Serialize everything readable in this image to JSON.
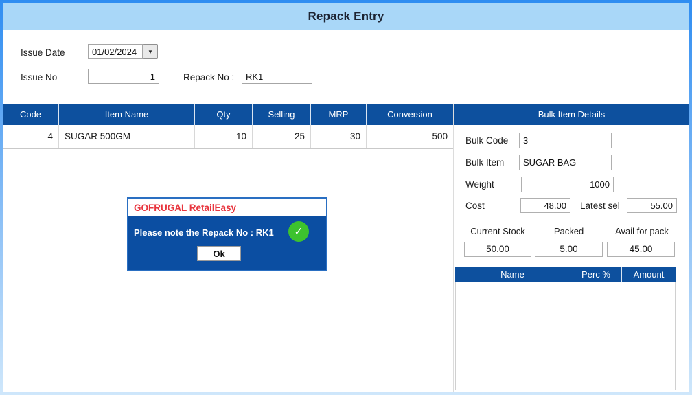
{
  "window": {
    "title": "Repack Entry"
  },
  "form": {
    "issue_date": {
      "label": "Issue Date",
      "value": "01/02/2024"
    },
    "issue_no": {
      "label": "Issue No",
      "value": "1"
    },
    "repack_no": {
      "label": "Repack No :",
      "value": "RK1"
    }
  },
  "items_table": {
    "columns": [
      "Code",
      "Item Name",
      "Qty",
      "Selling",
      "MRP",
      "Conversion"
    ],
    "rows": [
      {
        "code": "4",
        "item_name": "SUGAR 500GM",
        "qty": "10",
        "selling": "25",
        "mrp": "30",
        "conversion": "500"
      }
    ]
  },
  "bulk_panel": {
    "title": "Bulk Item Details",
    "bulk_code": {
      "label": "Bulk Code",
      "value": "3"
    },
    "bulk_item": {
      "label": "Bulk Item",
      "value": "SUGAR BAG"
    },
    "weight": {
      "label": "Weight",
      "value": "1000"
    },
    "cost": {
      "label": "Cost",
      "value": "48.00"
    },
    "latest_sel": {
      "label": "Latest sel",
      "value": "55.00"
    },
    "stock": {
      "current_stock": {
        "label": "Current Stock",
        "value": "50.00"
      },
      "packed": {
        "label": "Packed",
        "value": "5.00"
      },
      "avail_for_pack": {
        "label": "Avail for pack",
        "value": "45.00"
      }
    },
    "charges_table": {
      "columns": [
        "Name",
        "Perc %",
        "Amount"
      ],
      "rows": []
    }
  },
  "dialog": {
    "title": "GOFRUGAL RetailEasy",
    "message": "Please note the Repack No : RK1",
    "ok_label": "Ok"
  },
  "icons": {
    "dropdown_arrow": "▼",
    "check": "✓"
  },
  "colors": {
    "header_blue": "#0d509e",
    "titlebar_blue": "#a9d7f8",
    "window_border_blue": "#2f8df1",
    "dialog_title_red": "#e8353e",
    "success_green": "#3dc22e"
  }
}
